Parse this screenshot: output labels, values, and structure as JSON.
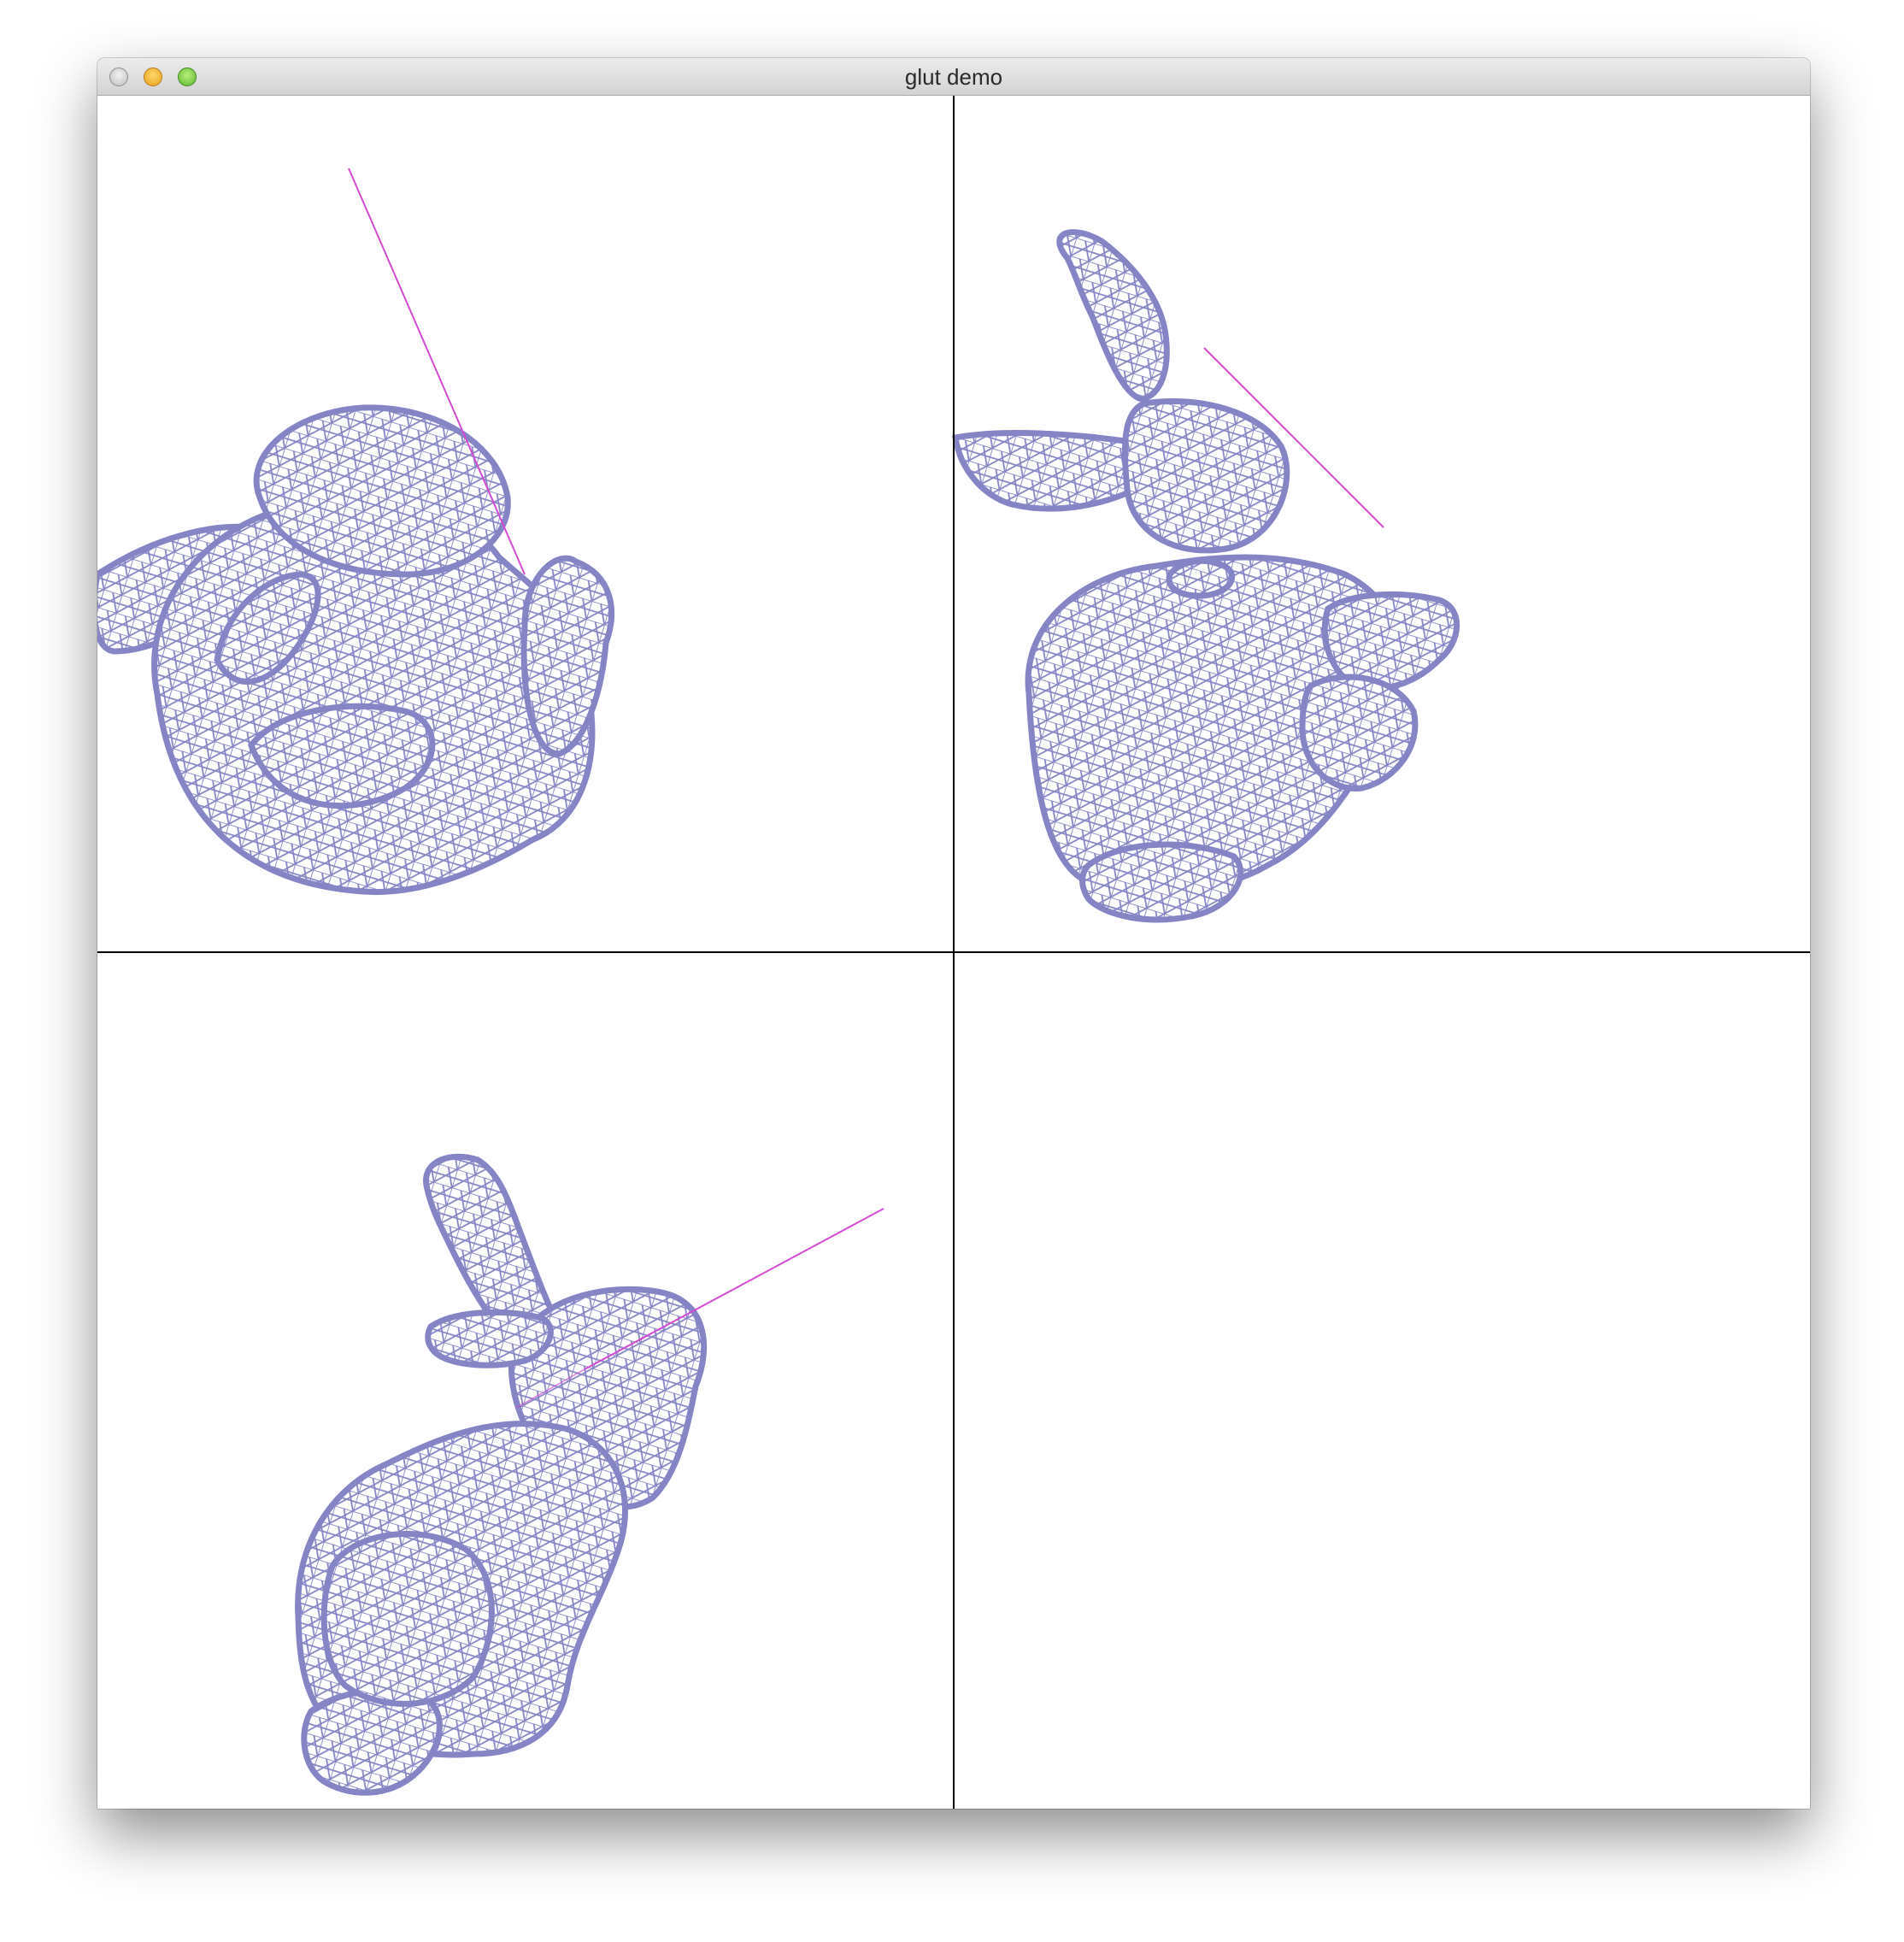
{
  "window": {
    "title": "glut demo"
  },
  "colors": {
    "mesh": "#8585c6",
    "pointer_line": "#d24bd2",
    "divider": "#000000",
    "background": "#ffffff"
  },
  "viewports": [
    {
      "name": "top-left",
      "content": "wireframe-bunny"
    },
    {
      "name": "top-right",
      "content": "wireframe-bunny"
    },
    {
      "name": "bottom-left",
      "content": "wireframe-bunny"
    },
    {
      "name": "bottom-right",
      "content": "empty"
    }
  ]
}
